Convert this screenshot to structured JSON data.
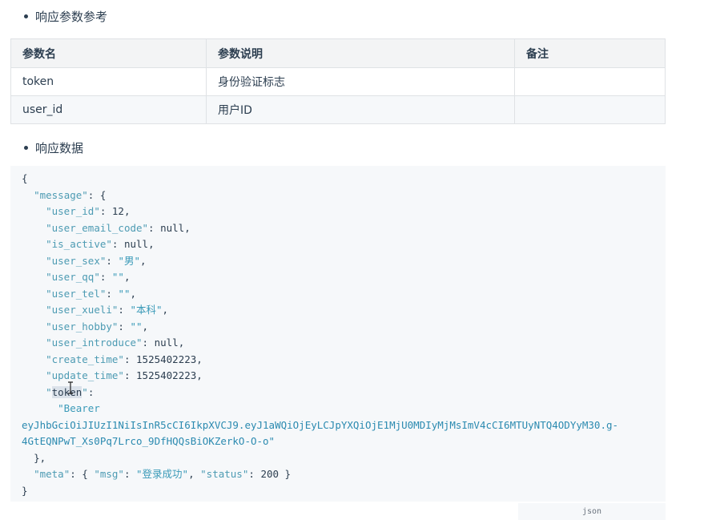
{
  "section1": {
    "title": "响应参数参考"
  },
  "table": {
    "headers": [
      "参数名",
      "参数说明",
      "备注"
    ],
    "rows": [
      [
        "token",
        "身份验证标志",
        ""
      ],
      [
        "user_id",
        "用户ID",
        ""
      ]
    ]
  },
  "section2": {
    "title": "响应数据"
  },
  "code": {
    "language": "json",
    "lines": [
      {
        "indent": "",
        "parts": [
          [
            "p",
            "{"
          ]
        ]
      },
      {
        "indent": "  ",
        "parts": [
          [
            "k",
            "\"message\""
          ],
          [
            "p",
            ": {"
          ]
        ]
      },
      {
        "indent": "    ",
        "parts": [
          [
            "k",
            "\"user_id\""
          ],
          [
            "p",
            ": "
          ],
          [
            "n",
            "12"
          ],
          [
            "p",
            ","
          ]
        ]
      },
      {
        "indent": "    ",
        "parts": [
          [
            "k",
            "\"user_email_code\""
          ],
          [
            "p",
            ": "
          ],
          [
            "null",
            "null"
          ],
          [
            "p",
            ","
          ]
        ]
      },
      {
        "indent": "    ",
        "parts": [
          [
            "k",
            "\"is_active\""
          ],
          [
            "p",
            ": "
          ],
          [
            "null",
            "null"
          ],
          [
            "p",
            ","
          ]
        ]
      },
      {
        "indent": "    ",
        "parts": [
          [
            "k",
            "\"user_sex\""
          ],
          [
            "p",
            ": "
          ],
          [
            "s",
            "\"男\""
          ],
          [
            "p",
            ","
          ]
        ]
      },
      {
        "indent": "    ",
        "parts": [
          [
            "k",
            "\"user_qq\""
          ],
          [
            "p",
            ": "
          ],
          [
            "s",
            "\"\""
          ],
          [
            "p",
            ","
          ]
        ]
      },
      {
        "indent": "    ",
        "parts": [
          [
            "k",
            "\"user_tel\""
          ],
          [
            "p",
            ": "
          ],
          [
            "s",
            "\"\""
          ],
          [
            "p",
            ","
          ]
        ]
      },
      {
        "indent": "    ",
        "parts": [
          [
            "k",
            "\"user_xueli\""
          ],
          [
            "p",
            ": "
          ],
          [
            "s",
            "\"本科\""
          ],
          [
            "p",
            ","
          ]
        ]
      },
      {
        "indent": "    ",
        "parts": [
          [
            "k",
            "\"user_hobby\""
          ],
          [
            "p",
            ": "
          ],
          [
            "s",
            "\"\""
          ],
          [
            "p",
            ","
          ]
        ]
      },
      {
        "indent": "    ",
        "parts": [
          [
            "k",
            "\"user_introduce\""
          ],
          [
            "p",
            ": "
          ],
          [
            "null",
            "null"
          ],
          [
            "p",
            ","
          ]
        ]
      },
      {
        "indent": "    ",
        "parts": [
          [
            "k",
            "\"create_time\""
          ],
          [
            "p",
            ": "
          ],
          [
            "n",
            "1525402223"
          ],
          [
            "p",
            ","
          ]
        ]
      },
      {
        "indent": "    ",
        "parts": [
          [
            "k",
            "\"update_time\""
          ],
          [
            "p",
            ": "
          ],
          [
            "n",
            "1525402223"
          ],
          [
            "p",
            ","
          ]
        ]
      },
      {
        "indent": "    ",
        "parts": [
          [
            "k",
            "\""
          ],
          [
            "hl",
            "token"
          ],
          [
            "k",
            "\""
          ],
          [
            "p",
            ":"
          ]
        ]
      },
      {
        "indent": "      ",
        "parts": [
          [
            "s",
            "\"Bearer"
          ]
        ]
      },
      {
        "indent": "",
        "parts": [
          [
            "tok",
            "eyJhbGciOiJIUzI1NiIsInR5cCI6IkpXVCJ9.eyJ1aWQiOjEyLCJpYXQiOjE1MjU0MDIyMjMsImV4cCI6MTUyNTQ4ODYyM30.g-"
          ]
        ]
      },
      {
        "indent": "",
        "parts": [
          [
            "tok",
            "4GtEQNPwT_Xs0Pq7Lrco_9DfHQQsBiOKZerkO-O-o\""
          ]
        ]
      },
      {
        "indent": "  ",
        "parts": [
          [
            "p",
            "},"
          ]
        ]
      },
      {
        "indent": "  ",
        "parts": [
          [
            "k",
            "\"meta\""
          ],
          [
            "p",
            ": { "
          ],
          [
            "k",
            "\"msg\""
          ],
          [
            "p",
            ": "
          ],
          [
            "s",
            "\"登录成功\""
          ],
          [
            "p",
            ", "
          ],
          [
            "k",
            "\"status\""
          ],
          [
            "p",
            ": "
          ],
          [
            "n",
            "200"
          ],
          [
            "p",
            " }"
          ]
        ]
      },
      {
        "indent": "",
        "parts": [
          [
            "p",
            "}"
          ]
        ]
      }
    ]
  }
}
